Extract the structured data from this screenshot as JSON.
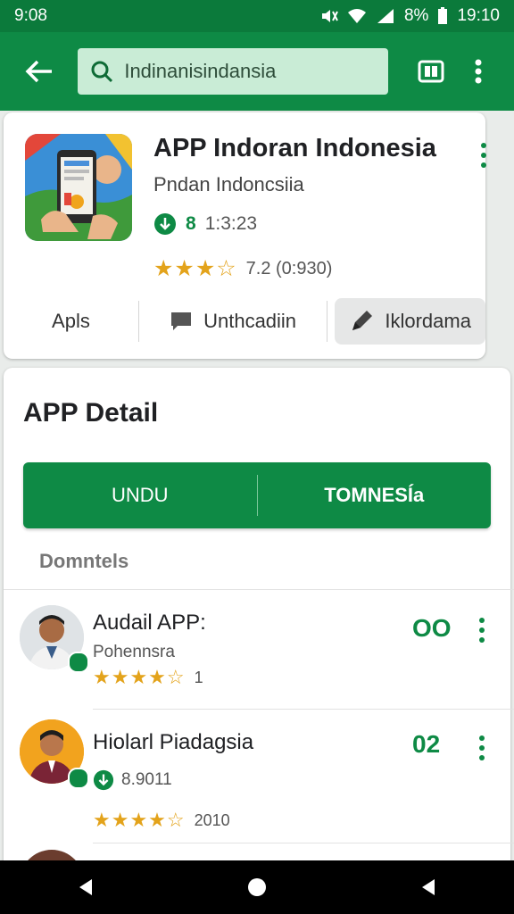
{
  "status_bar": {
    "time": "9:08",
    "battery": "8%",
    "clock": "19:10"
  },
  "search": {
    "value": "Indinanisindansia"
  },
  "app": {
    "title": "APP Indoran Indonesia",
    "developer": "Pndan Indoncsiia",
    "downloads": "1:3:23",
    "download_prefix": "8",
    "rating_text": "7.2 (0:930)",
    "rating_stars": 3.5
  },
  "actions": [
    {
      "label": "Apls"
    },
    {
      "label": "Unthcadiin"
    },
    {
      "label": "Iklordama"
    }
  ],
  "detail": {
    "title": "APP Detail",
    "tab_left": "UNDU",
    "tab_right": "TOMNESÍa",
    "section": "Domntels"
  },
  "list": [
    {
      "title": "Audail APP:",
      "subtitle": "Pohennsra",
      "rating_suffix": "1",
      "action": "OO",
      "rating_stars": 4
    },
    {
      "title": "Hiolarl Piadagsia",
      "subtitle": "8.9011",
      "rating_suffix": "2010",
      "action": "02",
      "rating_stars": 4.5
    }
  ],
  "colors": {
    "primary": "#0e8a45",
    "status": "#0b7a3b",
    "star": "#e3a31b"
  }
}
